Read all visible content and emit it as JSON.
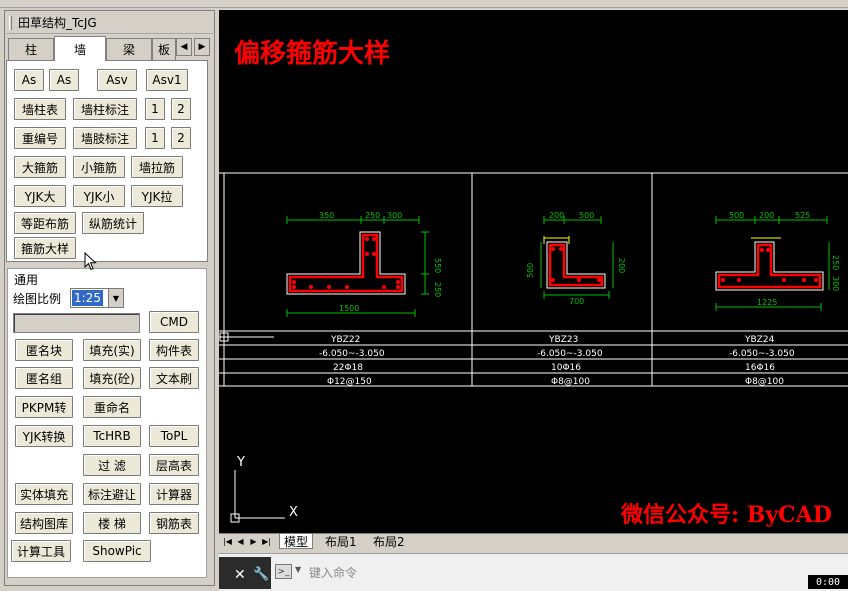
{
  "panel": {
    "title": "田草结构_TcJG",
    "tabs": [
      "柱",
      "墙",
      "梁",
      "板"
    ],
    "active_tab": 1,
    "tab_buttons": [
      "As",
      "As",
      "Asv",
      "Asv1",
      "墙柱表",
      "墙柱标注",
      "1",
      "2",
      "重编号",
      "墙肢标注",
      "1",
      "2",
      "大箍筋",
      "小箍筋",
      "墙拉筋",
      "YJK大",
      "YJK小",
      "YJK拉",
      "等距布筋",
      "纵筋统计",
      "箍筋大样"
    ],
    "group_label": "通用",
    "scale_label": "绘图比例",
    "scale_value": "1:25",
    "general_buttons": [
      "CMD",
      "匿名块",
      "填充(实)",
      "构件表",
      "匿名组",
      "填充(砼)",
      "文本刷",
      "PKPM转",
      "重命名",
      "YJK转换",
      "TcHRB",
      "ToPL",
      "过  滤",
      "层高表",
      "实体填充",
      "标注避让",
      "计算器",
      "结构图库",
      "楼  梯",
      "钢筋表",
      "计算工具",
      "ShowPic"
    ]
  },
  "canvas": {
    "heading": "偏移箍筋大样",
    "watermark": "微信公众号: ByCAD",
    "ucs_x": "X",
    "ucs_y": "Y",
    "sections": [
      {
        "name": "YBZ22",
        "elev": "-6.050~-3.050",
        "long_bar": "22Φ18",
        "stirrup": "Φ12@150",
        "dims_top": [
          "350",
          "250",
          "300"
        ],
        "dim_bottom": "1500",
        "dim_right": [
          "550",
          "250"
        ]
      },
      {
        "name": "YBZ23",
        "elev": "-6.050~-3.050",
        "long_bar": "10Φ16",
        "stirrup": "Φ8@100",
        "dims_top": [
          "200",
          "500"
        ],
        "dim_bottom": "700",
        "dim_left": "500",
        "dim_right": "200"
      },
      {
        "name": "YBZ24",
        "elev": "-6.050~-3.050",
        "long_bar": "16Φ16",
        "stirrup": "Φ8@100",
        "dims_top": [
          "500",
          "200",
          "525"
        ],
        "dim_bottom": "1225",
        "dim_right": [
          "250",
          "300"
        ]
      }
    ]
  },
  "layout_tabs": [
    "模型",
    "布局1",
    "布局2"
  ],
  "commandline": {
    "placeholder": "键入命令"
  },
  "timer": "0:00",
  "colors": {
    "heading": "#ff0000",
    "dim": "#00c000",
    "bar": "#ff0000",
    "text": "#ffffff",
    "marker": "#ffff00"
  }
}
